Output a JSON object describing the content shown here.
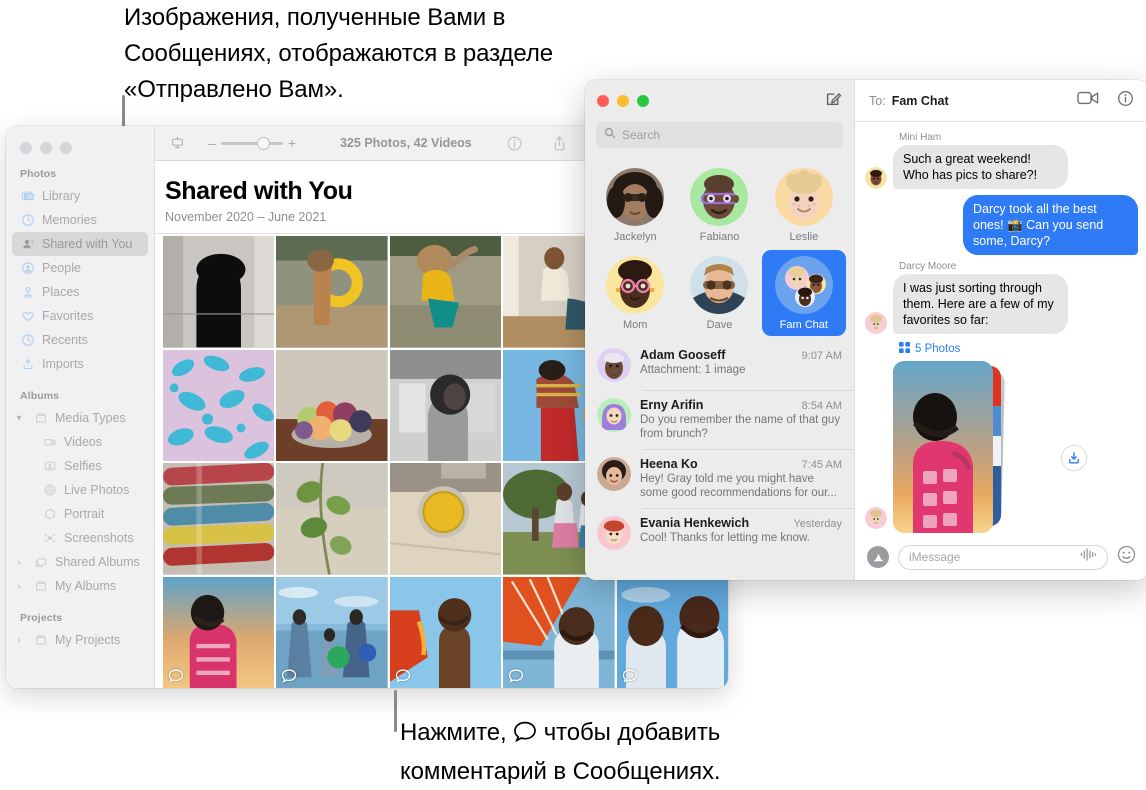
{
  "callouts": {
    "top": "Изображения, полученные Вами в Сообщениях, отображаются в разделе «Отправлено Вам».",
    "bottom_before": "Нажмите,",
    "bottom_after": "чтобы добавить комментарий в Сообщениях.",
    "bottom_icon": "comment-bubble-icon"
  },
  "photos": {
    "window_title": "Photos",
    "sidebar": {
      "groups": [
        {
          "title": "Photos",
          "items": [
            {
              "label": "Library",
              "icon": "library-icon",
              "selected": false
            },
            {
              "label": "Memories",
              "icon": "memories-icon",
              "selected": false
            },
            {
              "label": "Shared with You",
              "icon": "shared-with-you-icon",
              "selected": true
            },
            {
              "label": "People",
              "icon": "people-icon",
              "selected": false
            },
            {
              "label": "Places",
              "icon": "places-icon",
              "selected": false
            },
            {
              "label": "Favorites",
              "icon": "heart-icon",
              "selected": false
            },
            {
              "label": "Recents",
              "icon": "clock-icon",
              "selected": false
            },
            {
              "label": "Imports",
              "icon": "imports-icon",
              "selected": false
            }
          ]
        },
        {
          "title": "Albums",
          "items": [
            {
              "label": "Media Types",
              "icon": "folder-icon",
              "disclosure": "down"
            },
            {
              "label": "Videos",
              "icon": "video-icon",
              "indent": true
            },
            {
              "label": "Selfies",
              "icon": "selfie-icon",
              "indent": true
            },
            {
              "label": "Live Photos",
              "icon": "live-photo-icon",
              "indent": true
            },
            {
              "label": "Portrait",
              "icon": "portrait-icon",
              "indent": true
            },
            {
              "label": "Screenshots",
              "icon": "screenshot-icon",
              "indent": true
            },
            {
              "label": "Shared Albums",
              "icon": "shared-album-icon",
              "disclosure": "right"
            },
            {
              "label": "My Albums",
              "icon": "folder-icon",
              "disclosure": "right"
            }
          ]
        },
        {
          "title": "Projects",
          "items": [
            {
              "label": "My Projects",
              "icon": "folder-icon",
              "disclosure": "right"
            }
          ]
        }
      ]
    },
    "toolbar": {
      "view_icon": "view-options-icon",
      "zoom_out": "–",
      "zoom_in": "+",
      "zoom_value": 58,
      "count": "325 Photos, 42 Videos",
      "info_icon": "info-icon",
      "share_icon": "share-icon",
      "favorite_icon": "heart-icon",
      "rotate_icon": "rotate-icon"
    },
    "header": {
      "title": "Shared with You",
      "subtitle": "November 2020 – June 2021"
    },
    "grid": {
      "columns": 5,
      "cells": [
        {
          "id": "bw-silhouette-portrait",
          "comment": false
        },
        {
          "id": "child-yellow-float-river",
          "comment": false
        },
        {
          "id": "child-splashing-river",
          "comment": false
        },
        {
          "id": "man-sitting-studio",
          "comment": false
        },
        {
          "id": "yellow-fabric-partial",
          "comment": false
        },
        {
          "id": "blue-floral-textile",
          "comment": false
        },
        {
          "id": "fruit-bowl-table",
          "comment": false
        },
        {
          "id": "bw-woman-porch",
          "comment": false
        },
        {
          "id": "woman-red-pants-sky",
          "comment": false
        },
        {
          "id": "white-edge-partial",
          "comment": false
        },
        {
          "id": "stacked-colored-pipes",
          "comment": false
        },
        {
          "id": "green-leaves-vine",
          "comment": false
        },
        {
          "id": "yellow-bowl-kitchen",
          "comment": false
        },
        {
          "id": "family-under-tree",
          "comment": false
        },
        {
          "id": "cell-partial-blank",
          "comment": false
        },
        {
          "id": "woman-pink-dress-sunset",
          "comment": true
        },
        {
          "id": "family-beach-ball",
          "comment": true
        },
        {
          "id": "boy-orange-umbrella",
          "comment": true
        },
        {
          "id": "man-orange-sail",
          "comment": true
        },
        {
          "id": "father-and-son-sky",
          "comment": true
        }
      ]
    }
  },
  "messages": {
    "window_title": "Messages",
    "traffic_lights": {
      "close": "#ff5f57",
      "minimize": "#febc2e",
      "zoom": "#28c840"
    },
    "compose_icon": "compose-icon",
    "search": {
      "placeholder": "Search",
      "icon": "search-icon",
      "value": ""
    },
    "pinned": [
      {
        "name": "Jackelyn",
        "avatar": "photo-woman-sunglasses",
        "selected": false
      },
      {
        "name": "Fabiano",
        "avatar": "memoji-purple-glasses",
        "selected": false
      },
      {
        "name": "Leslie",
        "avatar": "memoji-blonde-curly",
        "selected": false
      },
      {
        "name": "Mom",
        "avatar": "memoji-pink-glasses",
        "selected": false
      },
      {
        "name": "Dave",
        "avatar": "photo-man-sunglasses",
        "selected": false
      },
      {
        "name": "Fam Chat",
        "avatar": "group-three-memoji",
        "selected": true
      }
    ],
    "conversations": [
      {
        "name": "Adam Gooseff",
        "time": "9:07 AM",
        "preview": "Attachment: 1 image",
        "avatar": "memoji-man-beanie"
      },
      {
        "name": "Erny Arifin",
        "time": "8:54 AM",
        "preview": "Do you remember the name of that guy from brunch?",
        "avatar": "memoji-hijab-purple"
      },
      {
        "name": "Heena Ko",
        "time": "7:45 AM",
        "preview": "Hey! Gray told me you might have some good recommendations for our...",
        "avatar": "photo-woman-bob"
      },
      {
        "name": "Evania Henkewich",
        "time": "Yesterday",
        "preview": "Cool! Thanks for letting me know.",
        "avatar": "memoji-red-headband"
      }
    ],
    "thread": {
      "to_label": "To:",
      "recipient": "Fam Chat",
      "facetime_icon": "facetime-video-icon",
      "info_icon": "info-icon",
      "messages": [
        {
          "sender": "Mini Ham",
          "text": "Such a great weekend! Who has pics to share?!",
          "direction": "in",
          "avatar": "memoji-yellow-bg"
        },
        {
          "sender": "",
          "text": "Darcy took all the best ones! 📸 Can you send some, Darcy?",
          "direction": "out"
        },
        {
          "sender": "Darcy Moore",
          "text": "I was just sorting through them. Here are a few of my favorites so far:",
          "direction": "in",
          "avatar": "memoji-pink-bg"
        }
      ],
      "attachment": {
        "label": "5 Photos",
        "icon": "grid-4-icon",
        "count": 5,
        "download_icon": "download-icon",
        "top_photo": "woman-pink-dress-sunset"
      },
      "composer": {
        "app_store_icon": "app-store-icon",
        "placeholder": "iMessage",
        "value": "",
        "audio_icon": "audio-waveform-icon",
        "emoji_icon": "emoji-smiley-icon"
      }
    }
  }
}
